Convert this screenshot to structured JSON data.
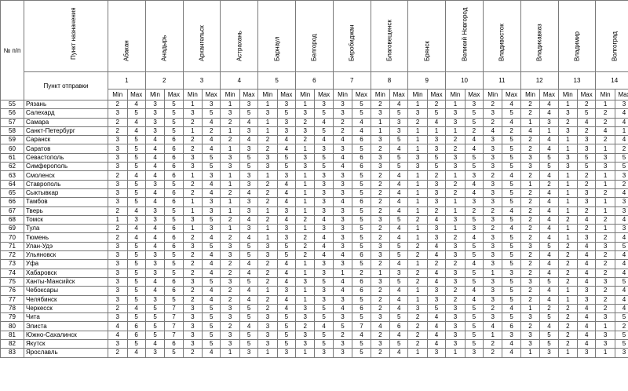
{
  "header": {
    "num_label": "№ п/п",
    "dest_label": "Пункт назначения",
    "origin_label": "Пункт отправки",
    "min_label": "Min",
    "max_label": "Max"
  },
  "destinations": [
    {
      "name": "Абакан",
      "n": "1"
    },
    {
      "name": "Анадырь",
      "n": "2"
    },
    {
      "name": "Архангельск",
      "n": "3"
    },
    {
      "name": "Астрахань",
      "n": "4"
    },
    {
      "name": "Барнаул",
      "n": "5"
    },
    {
      "name": "Белгород",
      "n": "6"
    },
    {
      "name": "Биробиджан",
      "n": "7"
    },
    {
      "name": "Благовещенск",
      "n": "8"
    },
    {
      "name": "Брянск",
      "n": "9"
    },
    {
      "name": "Великий Новгород",
      "n": "10"
    },
    {
      "name": "Владивосток",
      "n": "11"
    },
    {
      "name": "Владикавказ",
      "n": "12"
    },
    {
      "name": "Владимир",
      "n": "13"
    },
    {
      "name": "Волгоград",
      "n": "14"
    }
  ],
  "rows": [
    {
      "n": "55",
      "city": "Рязань",
      "v": [
        "2",
        "4",
        "3",
        "5",
        "1",
        "3",
        "1",
        "3",
        "1",
        "3",
        "1",
        "3",
        "3",
        "5",
        "2",
        "4",
        "1",
        "2",
        "1",
        "3",
        "2",
        "4",
        "2",
        "4",
        "1",
        "2",
        "1",
        "3"
      ]
    },
    {
      "n": "56",
      "city": "Салехард",
      "v": [
        "3",
        "5",
        "3",
        "5",
        "3",
        "5",
        "3",
        "5",
        "3",
        "5",
        "3",
        "5",
        "3",
        "5",
        "3",
        "5",
        "3",
        "5",
        "3",
        "5",
        "3",
        "5",
        "2",
        "4",
        "3",
        "5",
        "2",
        "4"
      ]
    },
    {
      "n": "57",
      "city": "Самара",
      "v": [
        "2",
        "4",
        "3",
        "5",
        "2",
        "4",
        "2",
        "4",
        "1",
        "3",
        "2",
        "4",
        "2",
        "4",
        "1",
        "3",
        "2",
        "4",
        "3",
        "5",
        "2",
        "4",
        "1",
        "3",
        "2",
        "4",
        "2",
        "4"
      ]
    },
    {
      "n": "58",
      "city": "Санкт-Петербург",
      "v": [
        "2",
        "4",
        "3",
        "5",
        "1",
        "2",
        "1",
        "3",
        "1",
        "3",
        "3",
        "5",
        "2",
        "4",
        "1",
        "3",
        "1",
        "1",
        "1",
        "2",
        "4",
        "2",
        "4",
        "1",
        "3",
        "2",
        "4",
        "1"
      ]
    },
    {
      "n": "59",
      "city": "Саранск",
      "v": [
        "3",
        "5",
        "4",
        "6",
        "2",
        "4",
        "2",
        "4",
        "2",
        "4",
        "2",
        "4",
        "4",
        "6",
        "3",
        "5",
        "1",
        "3",
        "2",
        "4",
        "3",
        "5",
        "2",
        "4",
        "1",
        "3",
        "2",
        "4"
      ]
    },
    {
      "n": "60",
      "city": "Саратов",
      "v": [
        "3",
        "5",
        "4",
        "6",
        "2",
        "4",
        "1",
        "3",
        "2",
        "4",
        "1",
        "3",
        "3",
        "5",
        "2",
        "4",
        "1",
        "3",
        "2",
        "4",
        "3",
        "5",
        "2",
        "4",
        "1",
        "3",
        "1",
        "2"
      ]
    },
    {
      "n": "61",
      "city": "Севастополь",
      "v": [
        "3",
        "5",
        "4",
        "6",
        "3",
        "5",
        "3",
        "5",
        "3",
        "5",
        "3",
        "5",
        "4",
        "6",
        "3",
        "5",
        "3",
        "5",
        "3",
        "5",
        "3",
        "5",
        "3",
        "5",
        "3",
        "5",
        "3",
        "5"
      ]
    },
    {
      "n": "62",
      "city": "Симферополь",
      "v": [
        "3",
        "5",
        "4",
        "6",
        "3",
        "5",
        "3",
        "5",
        "3",
        "5",
        "3",
        "5",
        "4",
        "6",
        "3",
        "5",
        "3",
        "5",
        "3",
        "5",
        "3",
        "5",
        "3",
        "5",
        "3",
        "5",
        "3",
        "5"
      ]
    },
    {
      "n": "63",
      "city": "Смоленск",
      "v": [
        "2",
        "4",
        "4",
        "6",
        "1",
        "3",
        "1",
        "3",
        "1",
        "3",
        "1",
        "3",
        "3",
        "5",
        "2",
        "4",
        "1",
        "2",
        "1",
        "3",
        "2",
        "4",
        "2",
        "4",
        "1",
        "2",
        "1",
        "3"
      ]
    },
    {
      "n": "64",
      "city": "Ставрополь",
      "v": [
        "3",
        "5",
        "3",
        "5",
        "2",
        "4",
        "1",
        "3",
        "2",
        "4",
        "1",
        "3",
        "3",
        "5",
        "2",
        "4",
        "1",
        "3",
        "2",
        "4",
        "3",
        "5",
        "1",
        "2",
        "1",
        "2",
        "1",
        "2"
      ]
    },
    {
      "n": "65",
      "city": "Сыктывкар",
      "v": [
        "3",
        "5",
        "4",
        "6",
        "2",
        "4",
        "2",
        "4",
        "2",
        "4",
        "1",
        "3",
        "3",
        "5",
        "2",
        "4",
        "1",
        "3",
        "2",
        "4",
        "3",
        "5",
        "2",
        "4",
        "1",
        "3",
        "2",
        "4"
      ]
    },
    {
      "n": "66",
      "city": "Тамбов",
      "v": [
        "3",
        "5",
        "4",
        "6",
        "1",
        "3",
        "1",
        "3",
        "2",
        "4",
        "1",
        "3",
        "4",
        "6",
        "2",
        "4",
        "1",
        "3",
        "1",
        "3",
        "3",
        "5",
        "2",
        "4",
        "1",
        "3",
        "1",
        "3"
      ]
    },
    {
      "n": "67",
      "city": "Тверь",
      "v": [
        "2",
        "4",
        "3",
        "5",
        "1",
        "3",
        "1",
        "3",
        "1",
        "3",
        "1",
        "3",
        "3",
        "5",
        "2",
        "4",
        "1",
        "2",
        "1",
        "2",
        "2",
        "4",
        "2",
        "4",
        "1",
        "2",
        "1",
        "3"
      ]
    },
    {
      "n": "68",
      "city": "Томск",
      "v": [
        "1",
        "3",
        "3",
        "5",
        "3",
        "5",
        "2",
        "4",
        "2",
        "4",
        "2",
        "4",
        "3",
        "5",
        "3",
        "5",
        "2",
        "4",
        "3",
        "5",
        "3",
        "5",
        "2",
        "4",
        "2",
        "4",
        "2",
        "4"
      ]
    },
    {
      "n": "69",
      "city": "Тула",
      "v": [
        "2",
        "4",
        "4",
        "6",
        "1",
        "3",
        "1",
        "3",
        "1",
        "3",
        "1",
        "3",
        "3",
        "5",
        "2",
        "4",
        "1",
        "3",
        "1",
        "3",
        "2",
        "4",
        "2",
        "4",
        "1",
        "2",
        "1",
        "3"
      ]
    },
    {
      "n": "70",
      "city": "Тюмень",
      "v": [
        "2",
        "4",
        "4",
        "6",
        "2",
        "4",
        "2",
        "4",
        "1",
        "3",
        "2",
        "4",
        "3",
        "5",
        "2",
        "4",
        "1",
        "3",
        "2",
        "4",
        "3",
        "5",
        "2",
        "4",
        "1",
        "3",
        "2",
        "4"
      ]
    },
    {
      "n": "71",
      "city": "Улан-Удэ",
      "v": [
        "3",
        "5",
        "4",
        "6",
        "3",
        "5",
        "3",
        "5",
        "3",
        "5",
        "2",
        "4",
        "3",
        "5",
        "3",
        "5",
        "2",
        "4",
        "3",
        "5",
        "3",
        "5",
        "3",
        "5",
        "2",
        "4",
        "3",
        "5"
      ]
    },
    {
      "n": "72",
      "city": "Ульяновск",
      "v": [
        "3",
        "5",
        "3",
        "5",
        "2",
        "4",
        "3",
        "5",
        "3",
        "5",
        "2",
        "4",
        "4",
        "6",
        "3",
        "5",
        "2",
        "4",
        "3",
        "5",
        "3",
        "5",
        "2",
        "4",
        "2",
        "4",
        "2",
        "4"
      ]
    },
    {
      "n": "73",
      "city": "Уфа",
      "v": [
        "3",
        "5",
        "3",
        "5",
        "2",
        "4",
        "2",
        "4",
        "2",
        "4",
        "1",
        "3",
        "3",
        "5",
        "2",
        "4",
        "1",
        "2",
        "2",
        "4",
        "3",
        "5",
        "2",
        "4",
        "2",
        "4",
        "2",
        "4"
      ]
    },
    {
      "n": "74",
      "city": "Хабаровск",
      "v": [
        "3",
        "5",
        "3",
        "5",
        "2",
        "4",
        "2",
        "4",
        "2",
        "4",
        "1",
        "3",
        "1",
        "2",
        "1",
        "3",
        "2",
        "4",
        "3",
        "5",
        "1",
        "3",
        "2",
        "4",
        "2",
        "4",
        "2",
        "4"
      ]
    },
    {
      "n": "75",
      "city": "Ханты-Мансийск",
      "v": [
        "3",
        "5",
        "4",
        "6",
        "3",
        "5",
        "3",
        "5",
        "2",
        "4",
        "3",
        "5",
        "4",
        "6",
        "3",
        "5",
        "2",
        "4",
        "3",
        "5",
        "3",
        "5",
        "3",
        "5",
        "2",
        "4",
        "3",
        "5"
      ]
    },
    {
      "n": "76",
      "city": "Чебоксары",
      "v": [
        "3",
        "5",
        "4",
        "6",
        "2",
        "4",
        "2",
        "4",
        "1",
        "3",
        "1",
        "3",
        "4",
        "6",
        "2",
        "4",
        "1",
        "3",
        "2",
        "4",
        "3",
        "5",
        "2",
        "4",
        "1",
        "3",
        "2",
        "4"
      ]
    },
    {
      "n": "77",
      "city": "Челябинск",
      "v": [
        "3",
        "5",
        "3",
        "5",
        "2",
        "4",
        "2",
        "4",
        "2",
        "4",
        "1",
        "3",
        "3",
        "5",
        "2",
        "4",
        "1",
        "3",
        "2",
        "4",
        "3",
        "5",
        "2",
        "4",
        "1",
        "3",
        "2",
        "4"
      ]
    },
    {
      "n": "78",
      "city": "Черкесск",
      "v": [
        "2",
        "4",
        "5",
        "7",
        "3",
        "5",
        "3",
        "5",
        "2",
        "4",
        "3",
        "5",
        "4",
        "6",
        "2",
        "4",
        "3",
        "5",
        "3",
        "5",
        "2",
        "4",
        "1",
        "2",
        "2",
        "4",
        "2",
        "4"
      ]
    },
    {
      "n": "79",
      "city": "Чита",
      "v": [
        "3",
        "5",
        "5",
        "7",
        "3",
        "5",
        "3",
        "5",
        "3",
        "5",
        "3",
        "5",
        "3",
        "5",
        "3",
        "5",
        "2",
        "4",
        "3",
        "5",
        "3",
        "5",
        "3",
        "5",
        "2",
        "4",
        "3",
        "5"
      ]
    },
    {
      "n": "80",
      "city": "Элиста",
      "v": [
        "4",
        "6",
        "5",
        "7",
        "3",
        "5",
        "2",
        "4",
        "3",
        "5",
        "2",
        "4",
        "5",
        "7",
        "4",
        "6",
        "2",
        "4",
        "3",
        "5",
        "4",
        "6",
        "2",
        "4",
        "2",
        "4",
        "1",
        "2"
      ]
    },
    {
      "n": "81",
      "city": "Южно-Сахалинск",
      "v": [
        "4",
        "6",
        "5",
        "7",
        "3",
        "5",
        "3",
        "5",
        "3",
        "5",
        "3",
        "5",
        "2",
        "4",
        "2",
        "4",
        "2",
        "4",
        "3",
        "5",
        "1",
        "3",
        "3",
        "5",
        "2",
        "4",
        "3",
        "5"
      ]
    },
    {
      "n": "82",
      "city": "Якутск",
      "v": [
        "3",
        "5",
        "4",
        "6",
        "3",
        "5",
        "3",
        "5",
        "3",
        "5",
        "3",
        "5",
        "3",
        "5",
        "3",
        "5",
        "2",
        "4",
        "3",
        "5",
        "2",
        "4",
        "3",
        "5",
        "2",
        "4",
        "3",
        "5"
      ]
    },
    {
      "n": "83",
      "city": "Ярославль",
      "v": [
        "2",
        "4",
        "3",
        "5",
        "2",
        "4",
        "1",
        "3",
        "1",
        "3",
        "1",
        "3",
        "3",
        "5",
        "2",
        "4",
        "1",
        "3",
        "1",
        "3",
        "2",
        "4",
        "1",
        "3",
        "1",
        "3",
        "1",
        "3"
      ]
    }
  ]
}
